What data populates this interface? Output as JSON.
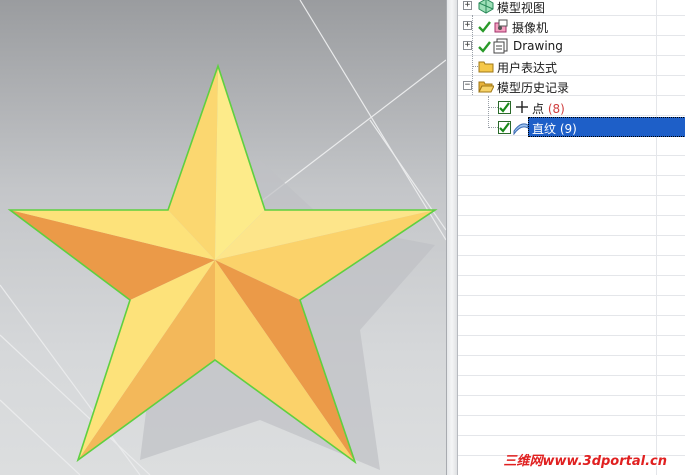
{
  "nav_tree": {
    "items": [
      {
        "label": "模型视图",
        "icon": "model-view-icon",
        "expander": "+"
      },
      {
        "label": "摄像机",
        "icon": "camera-icon",
        "expander": "+",
        "checked": true
      },
      {
        "label": "Drawing",
        "icon": "drawing-icon",
        "expander": "+",
        "checked": true
      },
      {
        "label": "用户表达式",
        "icon": "folder-icon"
      },
      {
        "label": "模型历史记录",
        "icon": "folder-open-icon",
        "expander": "−"
      }
    ],
    "children": [
      {
        "label": "点",
        "count": "(8)",
        "icon": "point-icon",
        "checked": true
      },
      {
        "label": "直纹",
        "count": "(9)",
        "icon": "ruled-surface-icon",
        "checked": true,
        "selected": true
      }
    ]
  },
  "watermark": "三维网www.3dportal.cn",
  "colors": {
    "selection": "#1e5fc8",
    "check_green": "#2a9a2a",
    "star_light": "#fde27a",
    "star_dark": "#eb9a48",
    "edge_green": "#5fd040",
    "watermark": "#e02020"
  }
}
